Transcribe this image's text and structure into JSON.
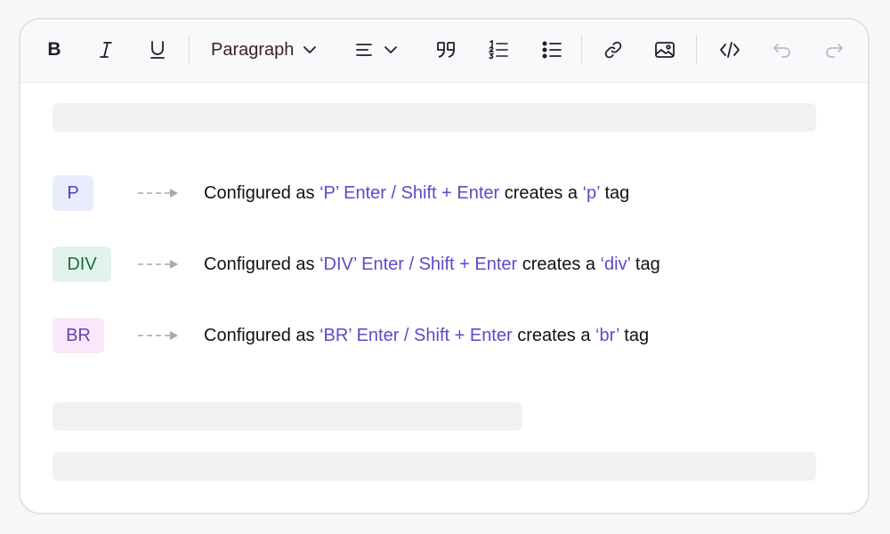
{
  "toolbar": {
    "format_label": "Paragraph",
    "icons": [
      "bold-icon",
      "italic-icon",
      "underline-icon",
      "chevron-down-icon",
      "align-left-icon",
      "blockquote-icon",
      "ordered-list-icon",
      "bullet-list-icon",
      "link-icon",
      "image-icon",
      "code-icon",
      "undo-icon",
      "redo-icon"
    ],
    "bold_glyph": "B"
  },
  "rows": [
    {
      "badge": "P",
      "badge_bg": "#e8ecfd",
      "badge_color": "#4a41c3",
      "prefix": "Configured as ",
      "config": "‘P’ Enter / Shift + Enter",
      "middle": " creates a ",
      "tag": "‘p’",
      "suffix": " tag"
    },
    {
      "badge": "DIV",
      "badge_bg": "#e1f3ea",
      "badge_color": "#1d6a4a",
      "prefix": "Configured as ",
      "config": "‘DIV’ Enter / Shift + Enter",
      "middle": " creates a ",
      "tag": "‘div’",
      "suffix": " tag"
    },
    {
      "badge": "BR",
      "badge_bg": "#fbe7fb",
      "badge_color": "#6e3fb0",
      "prefix": "Configured as ",
      "config": "‘BR’ Enter / Shift + Enter",
      "middle": " creates a ",
      "tag": "‘br’",
      "suffix": " tag"
    }
  ],
  "colors": {
    "highlight": "#5b4bc9",
    "arrow": "#a9a9ad"
  }
}
